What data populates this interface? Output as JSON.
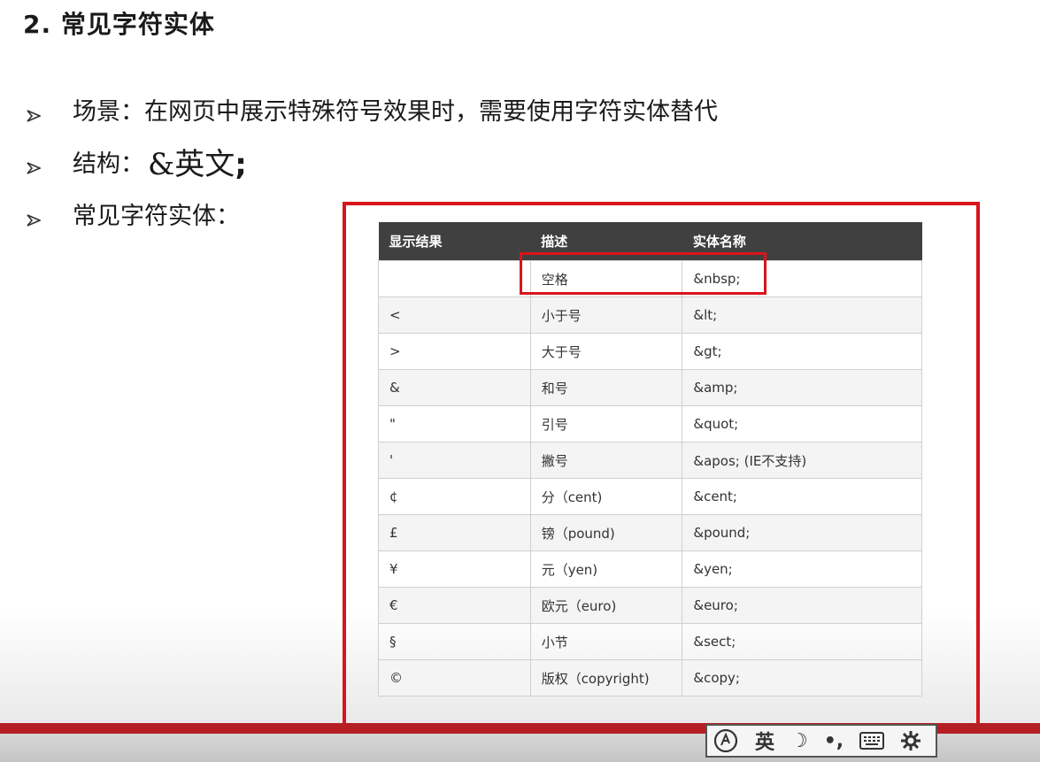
{
  "title": "2. 常见字符实体",
  "bullets": {
    "scene": "场景：在网页中展示特殊符号效果时，需要使用字符实体替代",
    "structure_label": "结构：",
    "structure_code": "&英文",
    "structure_semicolon": ";",
    "common": "常见字符实体："
  },
  "table": {
    "headers": [
      "显示结果",
      "描述",
      "实体名称"
    ],
    "rows": [
      [
        "",
        "空格",
        "&nbsp;"
      ],
      [
        "<",
        "小于号",
        "&lt;"
      ],
      [
        ">",
        "大于号",
        "&gt;"
      ],
      [
        "&",
        "和号",
        "&amp;"
      ],
      [
        "\"",
        "引号",
        "&quot;"
      ],
      [
        "'",
        "撇号",
        "&apos; (IE不支持)"
      ],
      [
        "¢",
        "分（cent)",
        "&cent;"
      ],
      [
        "£",
        "镑（pound)",
        "&pound;"
      ],
      [
        "¥",
        "元（yen)",
        "&yen;"
      ],
      [
        "€",
        "欧元（euro)",
        "&euro;"
      ],
      [
        "§",
        "小节",
        "&sect;"
      ],
      [
        "©",
        "版权（copyright)",
        "&copy;"
      ]
    ]
  },
  "ime_toolbar": {
    "lang": "英",
    "moon": "☽",
    "punct": "•,",
    "icons": [
      "ime-logo-icon",
      "moon-icon",
      "punctuation-icon",
      "keyboard-icon",
      "gear-icon"
    ]
  },
  "colors": {
    "accent_red": "#d8151c",
    "header_bg": "#404040",
    "bottom_bar": "#b51f24"
  }
}
